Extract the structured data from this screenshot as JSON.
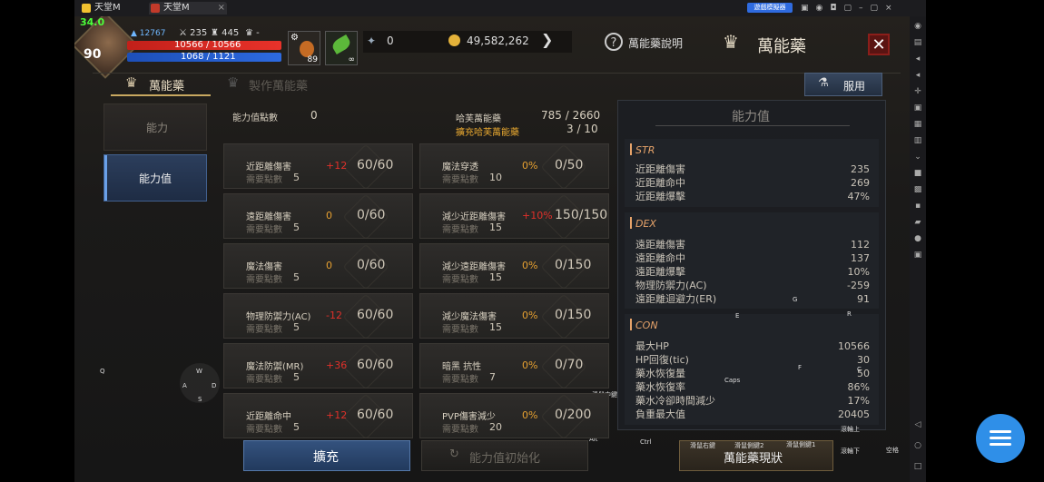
{
  "window": {
    "tab1": "天堂M",
    "tab2": "天堂M",
    "emulator_badge": "遊戲模擬器"
  },
  "player": {
    "fps": "34.0",
    "level": "90",
    "power": "12767",
    "stat_a": "235",
    "stat_b": "445",
    "stat_c": "-",
    "hp": "10566 / 10566",
    "mp": "1068 / 1121",
    "item_count": "89"
  },
  "currency": {
    "gems": "0",
    "gold": "49,582,262"
  },
  "header": {
    "help_label": "萬能藥說明",
    "title": "萬能藥"
  },
  "subtabs": {
    "tab1": "萬能藥",
    "tab2": "製作萬能藥",
    "use_button": "服用"
  },
  "left_nav": {
    "item1": "能力",
    "item2": "能力值"
  },
  "points": {
    "label": "能力值點數",
    "value": "0",
    "h_label": "哈芙萬能藥",
    "h_value": "785 / 2660",
    "ext_label": "擴充哈芙萬能藥",
    "ext_value": "3 / 10"
  },
  "req_label": "需要點數",
  "cells_left": [
    {
      "name": "近距離傷害",
      "req": "5",
      "bonus": "+12",
      "value": "60/60"
    },
    {
      "name": "遠距離傷害",
      "req": "5",
      "bonus": "0",
      "value": "0/60"
    },
    {
      "name": "魔法傷害",
      "req": "5",
      "bonus": "0",
      "value": "0/60"
    },
    {
      "name": "物理防禦力(AC)",
      "req": "5",
      "bonus": "-12",
      "value": "60/60"
    },
    {
      "name": "魔法防禦(MR)",
      "req": "5",
      "bonus": "+36",
      "value": "60/60"
    },
    {
      "name": "近距離命中",
      "req": "5",
      "bonus": "+12",
      "value": "60/60"
    }
  ],
  "cells_right": [
    {
      "name": "魔法穿透",
      "req": "10",
      "bonus": "0%",
      "value": "0/50"
    },
    {
      "name": "減少近距離傷害",
      "req": "15",
      "bonus": "+10%",
      "value": "150/150"
    },
    {
      "name": "減少遠距離傷害",
      "req": "15",
      "bonus": "0%",
      "value": "0/150"
    },
    {
      "name": "減少魔法傷害",
      "req": "15",
      "bonus": "0%",
      "value": "0/150"
    },
    {
      "name": "暗黑 抗性",
      "req": "7",
      "bonus": "0%",
      "value": "0/70"
    },
    {
      "name": "PVP傷害減少",
      "req": "20",
      "bonus": "0%",
      "value": "0/200"
    }
  ],
  "stats_panel": {
    "title": "能力值",
    "str": {
      "header": "STR",
      "rows": [
        [
          "近距離傷害",
          "235"
        ],
        [
          "近距離命中",
          "269"
        ],
        [
          "近距離爆擊",
          "47%"
        ]
      ]
    },
    "dex": {
      "header": "DEX",
      "rows": [
        [
          "遠距離傷害",
          "112"
        ],
        [
          "遠距離命中",
          "137"
        ],
        [
          "遠距離爆擊",
          "10%"
        ],
        [
          "物理防禦力(AC)",
          "-259"
        ],
        [
          "遠距離迴避力(ER)",
          "91"
        ]
      ]
    },
    "con": {
      "header": "CON",
      "rows": [
        [
          "最大HP",
          "10566"
        ],
        [
          "HP回復(tic)",
          "30"
        ],
        [
          "藥水恢復量",
          "50"
        ],
        [
          "藥水恢復率",
          "86%"
        ],
        [
          "藥水冷卻時間減少",
          "17%"
        ],
        [
          "負重最大值",
          "20405"
        ]
      ]
    }
  },
  "buttons": {
    "expand": "擴充",
    "reset": "能力值初始化",
    "status": "萬能藥現狀"
  },
  "keys": {
    "q": "Q",
    "w": "W",
    "a": "A",
    "s": "S",
    "d": "D",
    "g": "G",
    "e": "E",
    "r": "R",
    "c": "C",
    "f": "F",
    "caps": "Caps",
    "alt": "Alt",
    "ctrl": "Ctrl",
    "m_mid": "滑鼠中鍵",
    "m_right": "滑鼠右鍵",
    "m_b2": "滑鼠側鍵2",
    "m_b1": "滑鼠側鍵1",
    "wheel_up": "滾輪上",
    "wheel_down": "滾輪下",
    "space": "空格"
  }
}
